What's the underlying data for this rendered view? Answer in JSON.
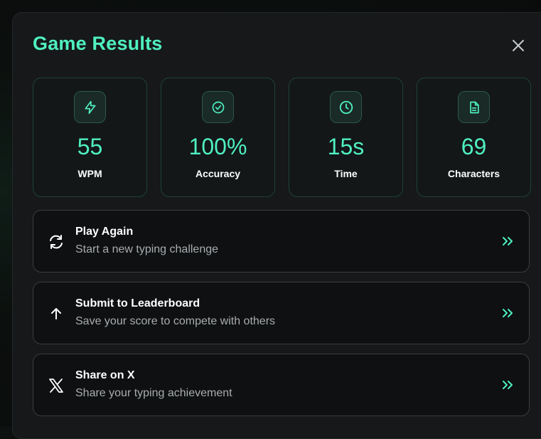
{
  "modal": {
    "title": "Game Results",
    "close_icon": "close-icon"
  },
  "stats": [
    {
      "icon": "lightning-icon",
      "value": "55",
      "label": "WPM"
    },
    {
      "icon": "check-circle-icon",
      "value": "100%",
      "label": "Accuracy"
    },
    {
      "icon": "clock-icon",
      "value": "15s",
      "label": "Time"
    },
    {
      "icon": "document-icon",
      "value": "69",
      "label": "Characters"
    }
  ],
  "actions": [
    {
      "icon": "refresh-icon",
      "title": "Play Again",
      "subtitle": "Start a new typing challenge"
    },
    {
      "icon": "arrow-up-icon",
      "title": "Submit to Leaderboard",
      "subtitle": "Save your score to compete with others"
    },
    {
      "icon": "x-logo-icon",
      "title": "Share on X",
      "subtitle": "Share your typing achievement"
    }
  ],
  "colors": {
    "accent": "#4ff0c0",
    "background": "#161819",
    "card_border": "#1f4237",
    "action_border": "#3a3e40",
    "muted_text": "#a9adb0"
  }
}
